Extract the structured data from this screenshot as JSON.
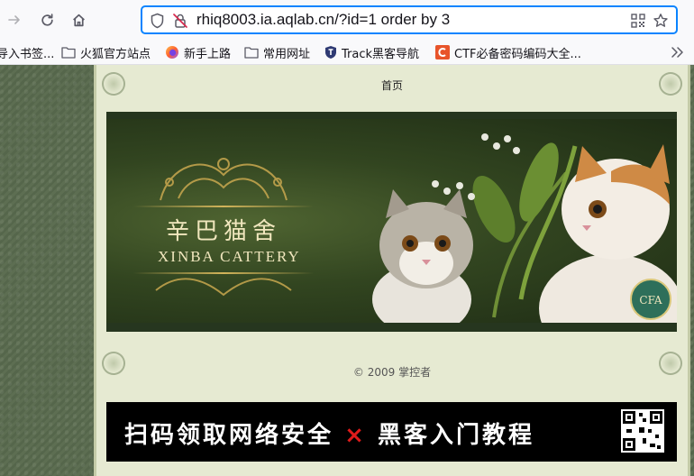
{
  "browser": {
    "url": "rhiq8003.ia.aqlab.cn/?id=1 order by 3",
    "bookmarks": [
      {
        "label": "导入书签...",
        "icon": "folder-icon"
      },
      {
        "label": "火狐官方站点",
        "icon": "folder-icon"
      },
      {
        "label": "新手上路",
        "icon": "firefox-icon"
      },
      {
        "label": "常用网址",
        "icon": "folder-icon"
      },
      {
        "label": "Track黑客导航",
        "icon": "track-shield-icon"
      },
      {
        "label": "CTF必备密码编码大全...",
        "icon": "ctf-c-icon"
      }
    ]
  },
  "page": {
    "nav_home": "首页",
    "banner_title_cn": "辛巴猫舍",
    "banner_title_en": "XINBA CATTERY",
    "footer": "© 2009 掌控者",
    "promo_part1": "扫码领取网络安全",
    "promo_x": "×",
    "promo_part2": "黑客入门教程"
  },
  "colors": {
    "url_focus": "#0a84ff",
    "page_bg": "#5a6b4f",
    "content_bg": "#e6ead2",
    "banner_bg": "#1c2a16",
    "banner_text": "#f1e7be",
    "promo_accent": "#e01b1b"
  }
}
